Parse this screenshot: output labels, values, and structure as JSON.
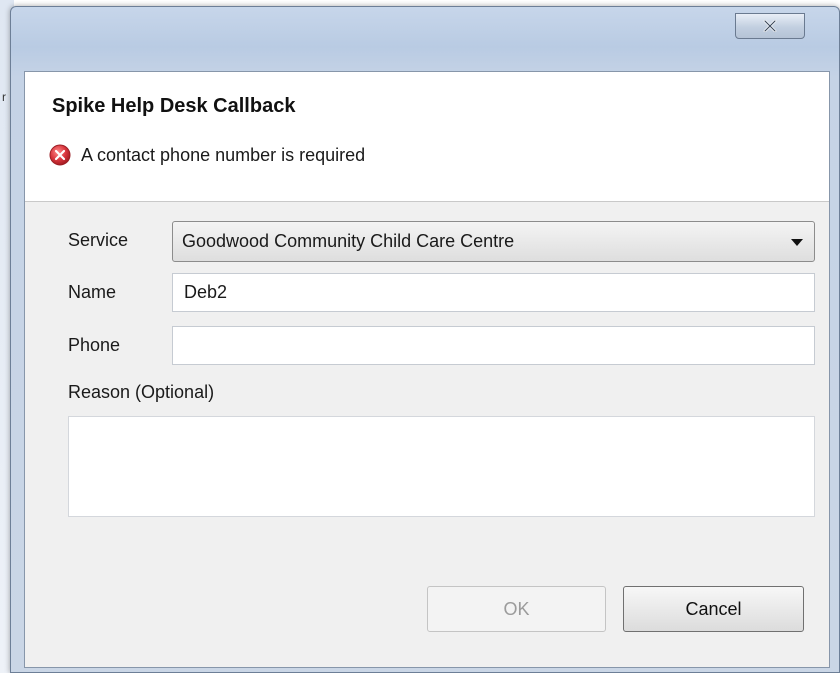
{
  "dialog": {
    "title": "Spike Help Desk Callback",
    "error_message": "A contact phone number is required"
  },
  "form": {
    "service_label": "Service",
    "service_value": "Goodwood Community Child Care Centre",
    "name_label": "Name",
    "name_value": "Deb2",
    "phone_label": "Phone",
    "phone_value": "",
    "reason_label": "Reason (Optional)",
    "reason_value": ""
  },
  "buttons": {
    "ok_label": "OK",
    "ok_enabled": false,
    "cancel_label": "Cancel"
  },
  "icons": {
    "close": "close-icon",
    "error": "error-icon",
    "dropdown": "chevron-down-icon"
  },
  "colors": {
    "error_red": "#d9363e",
    "title_bar": "#c7d6ea"
  }
}
